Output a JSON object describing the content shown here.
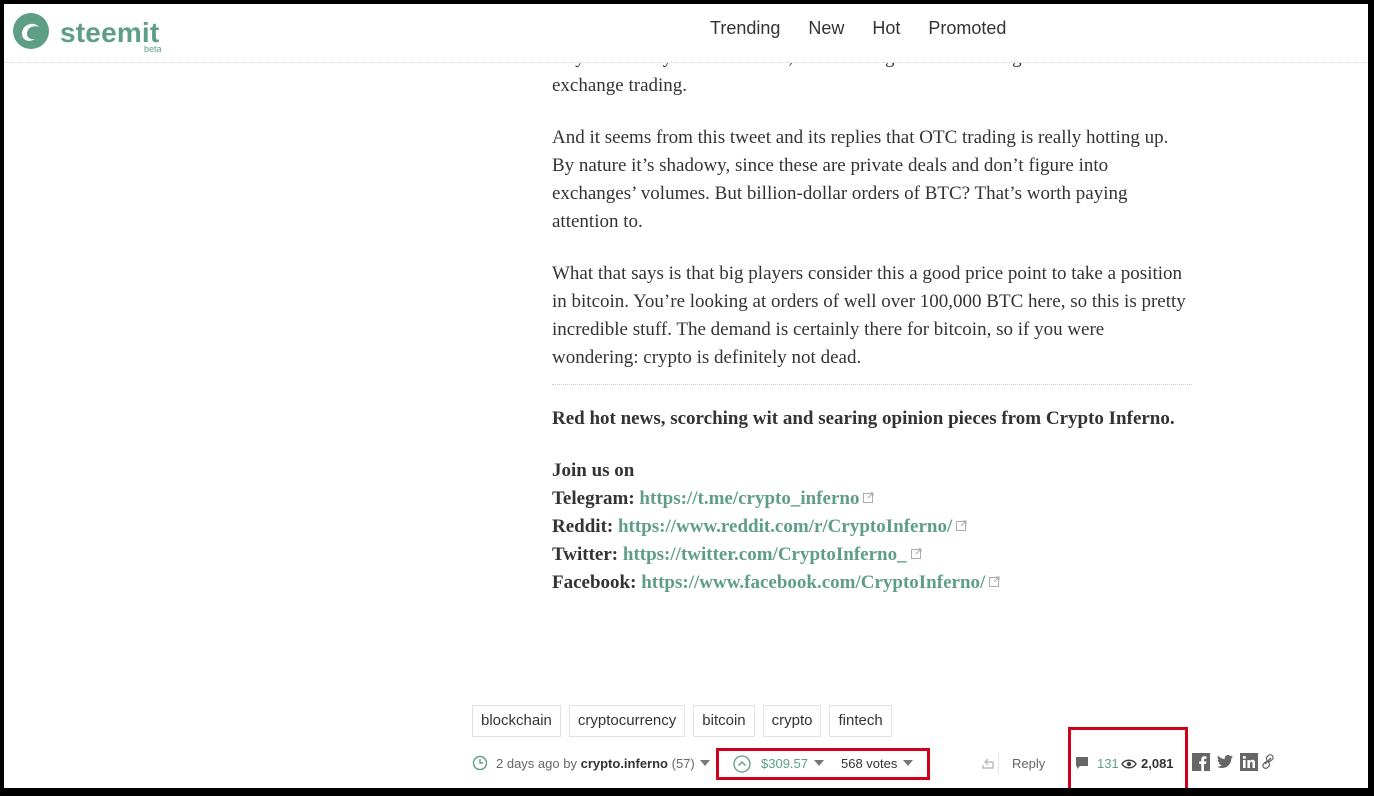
{
  "header": {
    "logo_text": "steemit",
    "logo_beta": "beta",
    "nav": [
      "Trending",
      "New",
      "Hot",
      "Promoted"
    ]
  },
  "article": {
    "p1": "maybe a lot. By some accounts, OTC trading accounts for higher volumes than on-exchange trading.",
    "p2": "And it seems from this tweet and its replies that OTC trading is really hotting up. By nature it’s shadowy, since these are private deals and don’t figure into exchanges’ volumes. But billion-dollar orders of BTC? That’s worth paying attention to.",
    "p3": "What that says is that big players consider this a good price point to take a position in bitcoin. You’re looking at orders of well over 100,000 BTC here, so this is pretty incredible stuff. The demand is certainly there for bitcoin, so if you were wondering: crypto is definitely not dead.",
    "promo": "Red hot news, scorching wit and searing opinion pieces from Crypto Inferno.",
    "join": "Join us on",
    "links": [
      {
        "label": "Telegram:",
        "url": "https://t.me/crypto_inferno"
      },
      {
        "label": "Reddit:",
        "url": "https://www.reddit.com/r/CryptoInferno/"
      },
      {
        "label": "Twitter:",
        "url": "https://twitter.com/CryptoInferno_"
      },
      {
        "label": "Facebook:",
        "url": "https://www.facebook.com/CryptoInferno/"
      }
    ]
  },
  "tags": [
    "blockchain",
    "cryptocurrency",
    "bitcoin",
    "crypto",
    "fintech"
  ],
  "meta": {
    "time": "2 days ago",
    "by": "by",
    "author": "crypto.inferno",
    "reputation": "(57)",
    "payout": "$309.57",
    "votes": "568 votes",
    "reply": "Reply",
    "comments": "131",
    "views": "2,081"
  },
  "icons": [
    "clock-icon",
    "upvote-icon",
    "reshare-icon",
    "comment-icon",
    "eye-icon",
    "facebook-icon",
    "twitter-icon",
    "linkedin-icon",
    "link-icon",
    "external-link-icon"
  ],
  "colors": {
    "accent": "#5e9e86",
    "highlight": "#d0021b"
  }
}
